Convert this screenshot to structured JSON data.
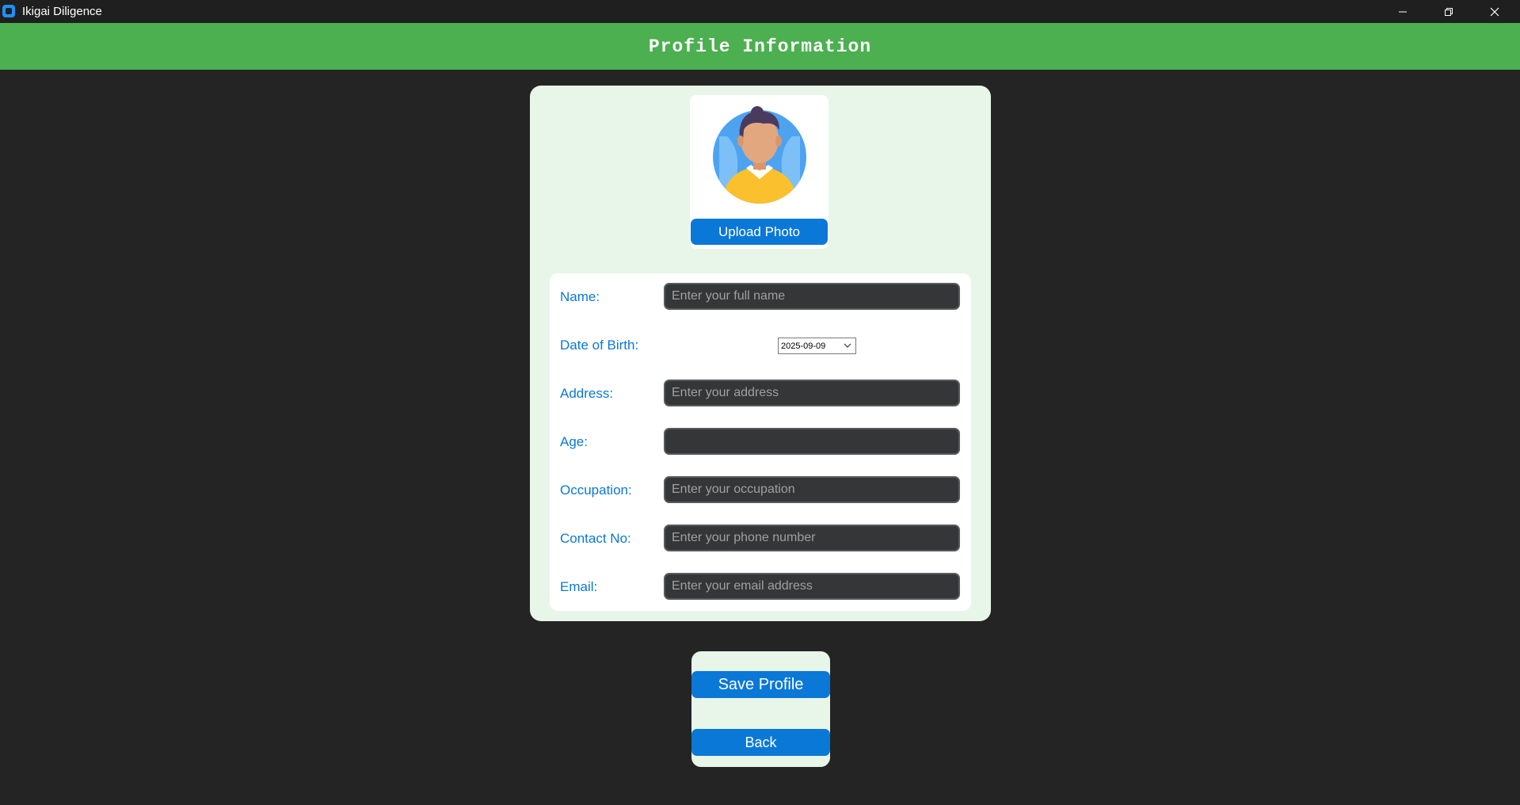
{
  "window": {
    "title": "Ikigai Diligence",
    "controls": [
      "minimize-icon",
      "restore-icon",
      "close-icon"
    ]
  },
  "header": {
    "title": "Profile Information",
    "color": "#4caf50"
  },
  "photo": {
    "avatar": "person-avatar-icon",
    "upload_label": "Upload Photo"
  },
  "form": {
    "name": {
      "label": "Name:",
      "placeholder": "Enter your full name",
      "value": ""
    },
    "dob": {
      "label": "Date of Birth:",
      "value": "2025-09-09"
    },
    "address": {
      "label": "Address:",
      "placeholder": "Enter your address",
      "value": ""
    },
    "age": {
      "label": "Age:",
      "placeholder": "",
      "value": ""
    },
    "occupation": {
      "label": "Occupation:",
      "placeholder": "Enter your occupation",
      "value": ""
    },
    "contact": {
      "label": "Contact No:",
      "placeholder": "Enter your phone number",
      "value": ""
    },
    "email": {
      "label": "Email:",
      "placeholder": "Enter your email address",
      "value": ""
    }
  },
  "actions": {
    "save_label": "Save Profile",
    "back_label": "Back"
  },
  "colors": {
    "accent": "#0a78d7",
    "background": "#242424",
    "card": "#e8f5e9",
    "field": "#343638"
  }
}
